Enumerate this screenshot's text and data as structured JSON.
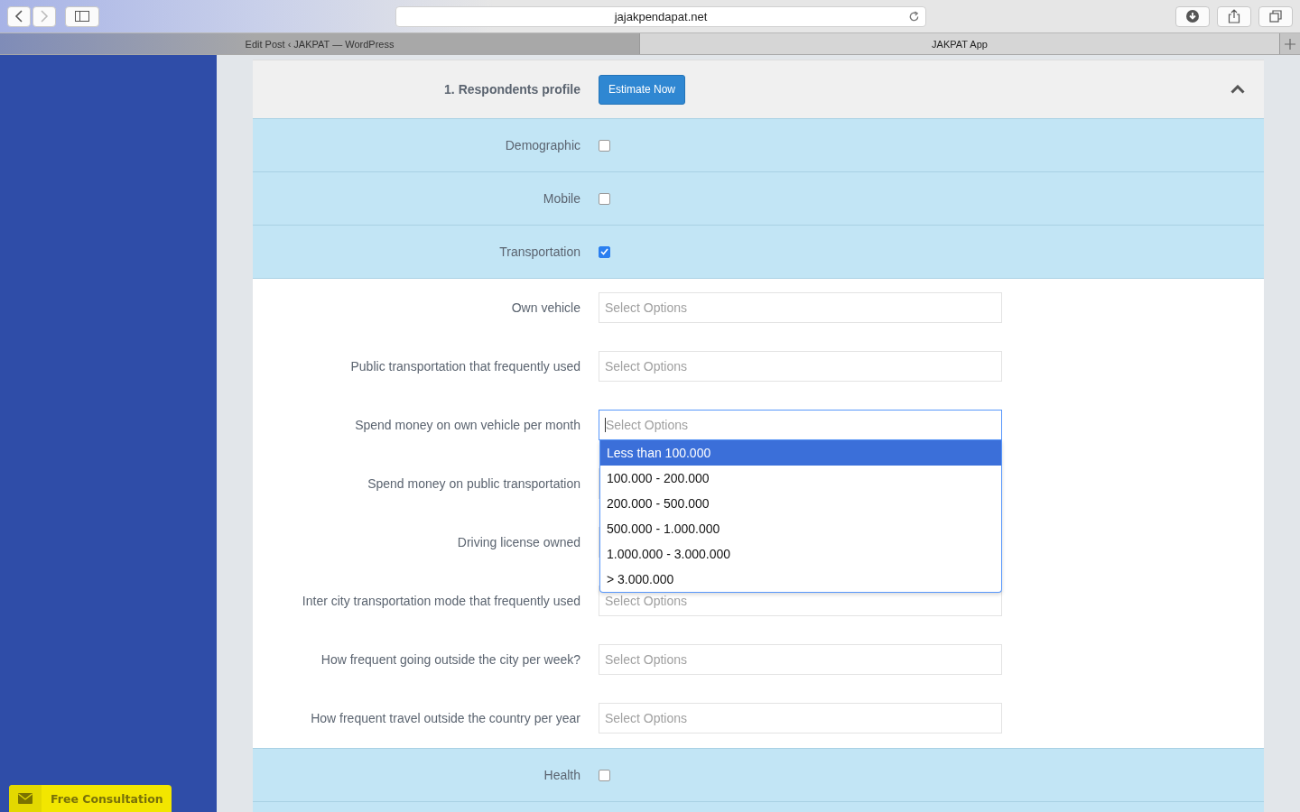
{
  "browser": {
    "url": "jajakpendapat.net",
    "tabs": [
      {
        "label": "Edit Post ‹ JAKPAT — WordPress",
        "selected": false
      },
      {
        "label": "JAKPAT App",
        "selected": true
      }
    ]
  },
  "sidebar": {
    "button": "Free Consultation"
  },
  "section": {
    "title": "1. Respondents profile",
    "button": "Estimate Now",
    "expanded": true
  },
  "rows": [
    {
      "kind": "category",
      "label": "Demographic",
      "checked": false
    },
    {
      "kind": "category",
      "label": "Mobile",
      "checked": false
    },
    {
      "kind": "category",
      "label": "Transportation",
      "checked": true
    },
    {
      "kind": "select",
      "label": "Own vehicle",
      "placeholder": "Select Options",
      "open": false
    },
    {
      "kind": "select",
      "label": "Public transportation that frequently used",
      "placeholder": "Select Options",
      "open": false
    },
    {
      "kind": "select",
      "label": "Spend money on own vehicle per month",
      "placeholder": "Select Options",
      "open": true,
      "options": [
        {
          "label": "Less than 100.000",
          "selected": true
        },
        {
          "label": "100.000 - 200.000",
          "selected": false
        },
        {
          "label": "200.000 - 500.000",
          "selected": false
        },
        {
          "label": "500.000 - 1.000.000",
          "selected": false
        },
        {
          "label": "1.000.000 - 3.000.000",
          "selected": false
        },
        {
          "label": "> 3.000.000",
          "selected": false
        }
      ]
    },
    {
      "kind": "select",
      "label": "Spend money on public transportation",
      "open": false
    },
    {
      "kind": "select",
      "label": "Driving license owned",
      "open": false
    },
    {
      "kind": "select",
      "label": "Inter city transportation mode that frequently used",
      "placeholder": "Select Options",
      "open": false
    },
    {
      "kind": "select",
      "label": "How frequent going outside the city per week?",
      "placeholder": "Select Options",
      "open": false
    },
    {
      "kind": "select",
      "label": "How frequent travel outside the country per year",
      "placeholder": "Select Options",
      "open": false
    },
    {
      "kind": "category",
      "label": "Health",
      "checked": false
    }
  ]
}
